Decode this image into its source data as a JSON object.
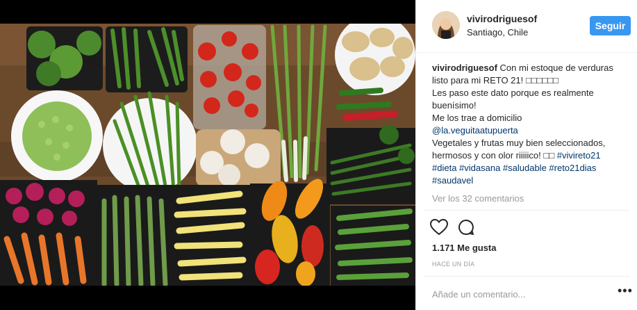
{
  "post": {
    "username": "vivirodriguesof",
    "location": "Santiago, Chile",
    "follow_label": "Seguir",
    "caption_lines": [
      "Con mi estoque de verduras listo para mi RETO 21! □□□□□□",
      "Les paso este dato porque es realmente buenísimo!",
      "Me los trae a domicilio"
    ],
    "mention": "@la.veguitaatupuerta",
    "caption_tail": "Vegetales y frutas muy bien seleccionados, hermosos y con olor riiiiico! □□",
    "hashtags_line1": "#vivireto21",
    "hashtags_line2": "#dieta #vidasana #saludable #reto21dias",
    "hashtags_line3": "#saudavel",
    "view_comments": "Ver los 32 comentarios",
    "likes": "1.171 Me gusta",
    "time": "HACE UN DÍA",
    "add_comment_placeholder": "Añade un comentario...",
    "more_dots": "•••"
  },
  "icons": [
    "heart-icon",
    "comment-icon"
  ],
  "colors": {
    "accent": "#3897f0",
    "link": "#003569",
    "muted": "#999999"
  }
}
